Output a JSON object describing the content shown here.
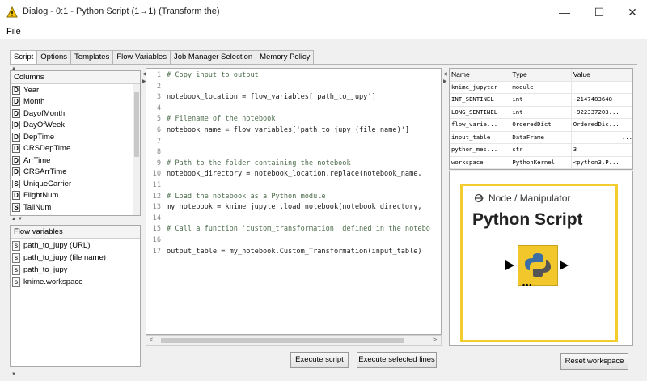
{
  "window": {
    "title": "Dialog - 0:1 - Python Script (1→1) (Transform the)",
    "minimize_glyph": "—",
    "maximize_glyph": "☐",
    "close_glyph": "✕"
  },
  "menu": {
    "file": "File"
  },
  "tabs": [
    {
      "label": "Script",
      "active": true
    },
    {
      "label": "Options"
    },
    {
      "label": "Templates"
    },
    {
      "label": "Flow Variables"
    },
    {
      "label": "Job Manager Selection"
    },
    {
      "label": "Memory Policy"
    }
  ],
  "columns": {
    "header": "Columns",
    "items": [
      {
        "type": "D",
        "name": "Year"
      },
      {
        "type": "D",
        "name": "Month"
      },
      {
        "type": "D",
        "name": "DayofMonth"
      },
      {
        "type": "D",
        "name": "DayOfWeek"
      },
      {
        "type": "D",
        "name": "DepTime"
      },
      {
        "type": "D",
        "name": "CRSDepTime"
      },
      {
        "type": "D",
        "name": "ArrTime"
      },
      {
        "type": "D",
        "name": "CRSArrTime"
      },
      {
        "type": "S",
        "name": "UniqueCarrier"
      },
      {
        "type": "D",
        "name": "FlightNum"
      },
      {
        "type": "S",
        "name": "TailNum"
      }
    ]
  },
  "flow_variables": {
    "header": "Flow variables",
    "items": [
      {
        "type": "s",
        "name": "path_to_jupy (URL)"
      },
      {
        "type": "s",
        "name": "path_to_jupy (file name)"
      },
      {
        "type": "s",
        "name": "path_to_jupy"
      },
      {
        "type": "s",
        "name": "knime.workspace"
      }
    ]
  },
  "code_lines": [
    {
      "n": "1",
      "text": "# Copy input to output",
      "comment": true
    },
    {
      "n": "2",
      "text": ""
    },
    {
      "n": "3",
      "text": "notebook_location = flow_variables['path_to_jupy']"
    },
    {
      "n": "4",
      "text": ""
    },
    {
      "n": "5",
      "text": "# Filename of the notebook",
      "comment": true
    },
    {
      "n": "6",
      "text": "notebook_name = flow_variables['path_to_jupy (file name)']"
    },
    {
      "n": "7",
      "text": ""
    },
    {
      "n": "8",
      "text": ""
    },
    {
      "n": "9",
      "text": "# Path to the folder containing the notebook",
      "comment": true
    },
    {
      "n": "10",
      "text": "notebook_directory = notebook_location.replace(notebook_name,"
    },
    {
      "n": "11",
      "text": ""
    },
    {
      "n": "12",
      "text": "# Load the notebook as a Python module",
      "comment": true
    },
    {
      "n": "13",
      "text": "my_notebook = knime_jupyter.load_notebook(notebook_directory,"
    },
    {
      "n": "14",
      "text": ""
    },
    {
      "n": "15",
      "text": "# Call a function 'custom_transformation' defined in the notebo",
      "comment": true
    },
    {
      "n": "16",
      "text": ""
    },
    {
      "n": "17",
      "text": "output_table = my_notebook.Custom_Transformation(input_table)"
    }
  ],
  "buttons": {
    "execute_script": "Execute script",
    "execute_selected": "Execute selected lines",
    "reset_workspace": "Reset workspace"
  },
  "variables_table": {
    "headers": [
      "Name",
      "Type",
      "Value"
    ],
    "rows": [
      [
        "knime_jupyter",
        "module",
        ""
      ],
      [
        "INT_SENTINEL",
        "int",
        "-2147483648"
      ],
      [
        "LONG_SENTINEL",
        "int",
        "-922337203..."
      ],
      [
        "flow_varie...",
        "OrderedDict",
        "OrderedDic..."
      ],
      [
        "input_table",
        "DataFrame",
        "..."
      ],
      [
        "python_mes...",
        "str",
        "3"
      ],
      [
        "workspace",
        "PythonKernel",
        "<python3.P..."
      ]
    ]
  },
  "node": {
    "kind": "Node / Manipulator",
    "name": "Python Script",
    "accent": "#f2c72b"
  }
}
